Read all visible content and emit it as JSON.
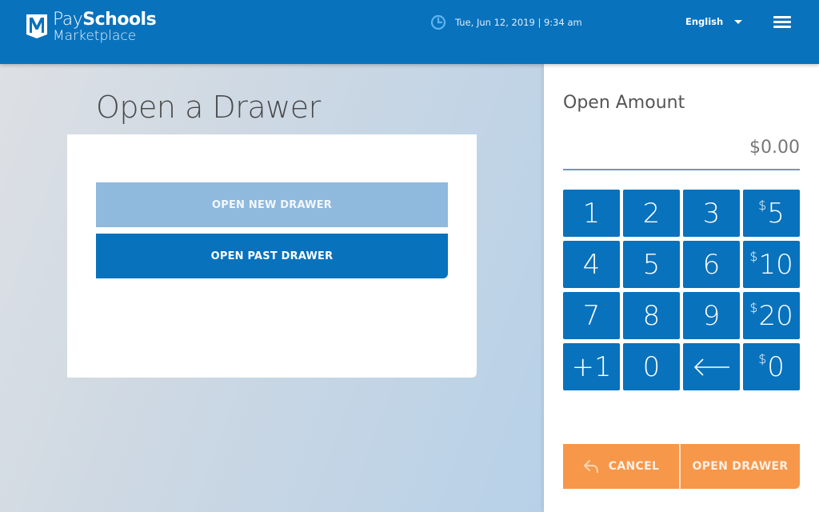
{
  "header": {
    "logo": {
      "line1_light": "Pay",
      "line1_bold": "Schools",
      "line2": "Marketplace",
      "icon": "paySchools-M-logo-icon"
    },
    "datetime": {
      "icon": "clock-icon",
      "text": "Tue, Jun 12, 2019 | 9:34 am"
    },
    "language": {
      "selected": "English",
      "icon": "caret-down-icon"
    },
    "menu": {
      "icon": "hamburger-menu-icon"
    }
  },
  "main": {
    "title": "Open a Drawer",
    "buttons": {
      "open_new": "OPEN NEW DRAWER",
      "open_past": "OPEN PAST DRAWER"
    }
  },
  "panel": {
    "label": "Open Amount",
    "value": "$0.00",
    "keypad": [
      {
        "label": "1"
      },
      {
        "label": "2"
      },
      {
        "label": "3"
      },
      {
        "prefix": "$",
        "label": "5"
      },
      {
        "label": "4"
      },
      {
        "label": "5"
      },
      {
        "label": "6"
      },
      {
        "prefix": "$",
        "label": "10"
      },
      {
        "label": "7"
      },
      {
        "label": "8"
      },
      {
        "label": "9"
      },
      {
        "prefix": "$",
        "label": "20"
      },
      {
        "label": "+1"
      },
      {
        "label": "0"
      },
      {
        "icon": "backspace-arrow-icon"
      },
      {
        "prefix": "$",
        "label": "0"
      }
    ],
    "actions": {
      "cancel": "CANCEL",
      "cancel_icon": "reply-arrow-icon",
      "open_drawer": "OPEN DRAWER"
    }
  },
  "colors": {
    "brand_blue": "#0872bd",
    "light_blue": "#8fb9dd",
    "accent_orange": "#f7974a"
  }
}
